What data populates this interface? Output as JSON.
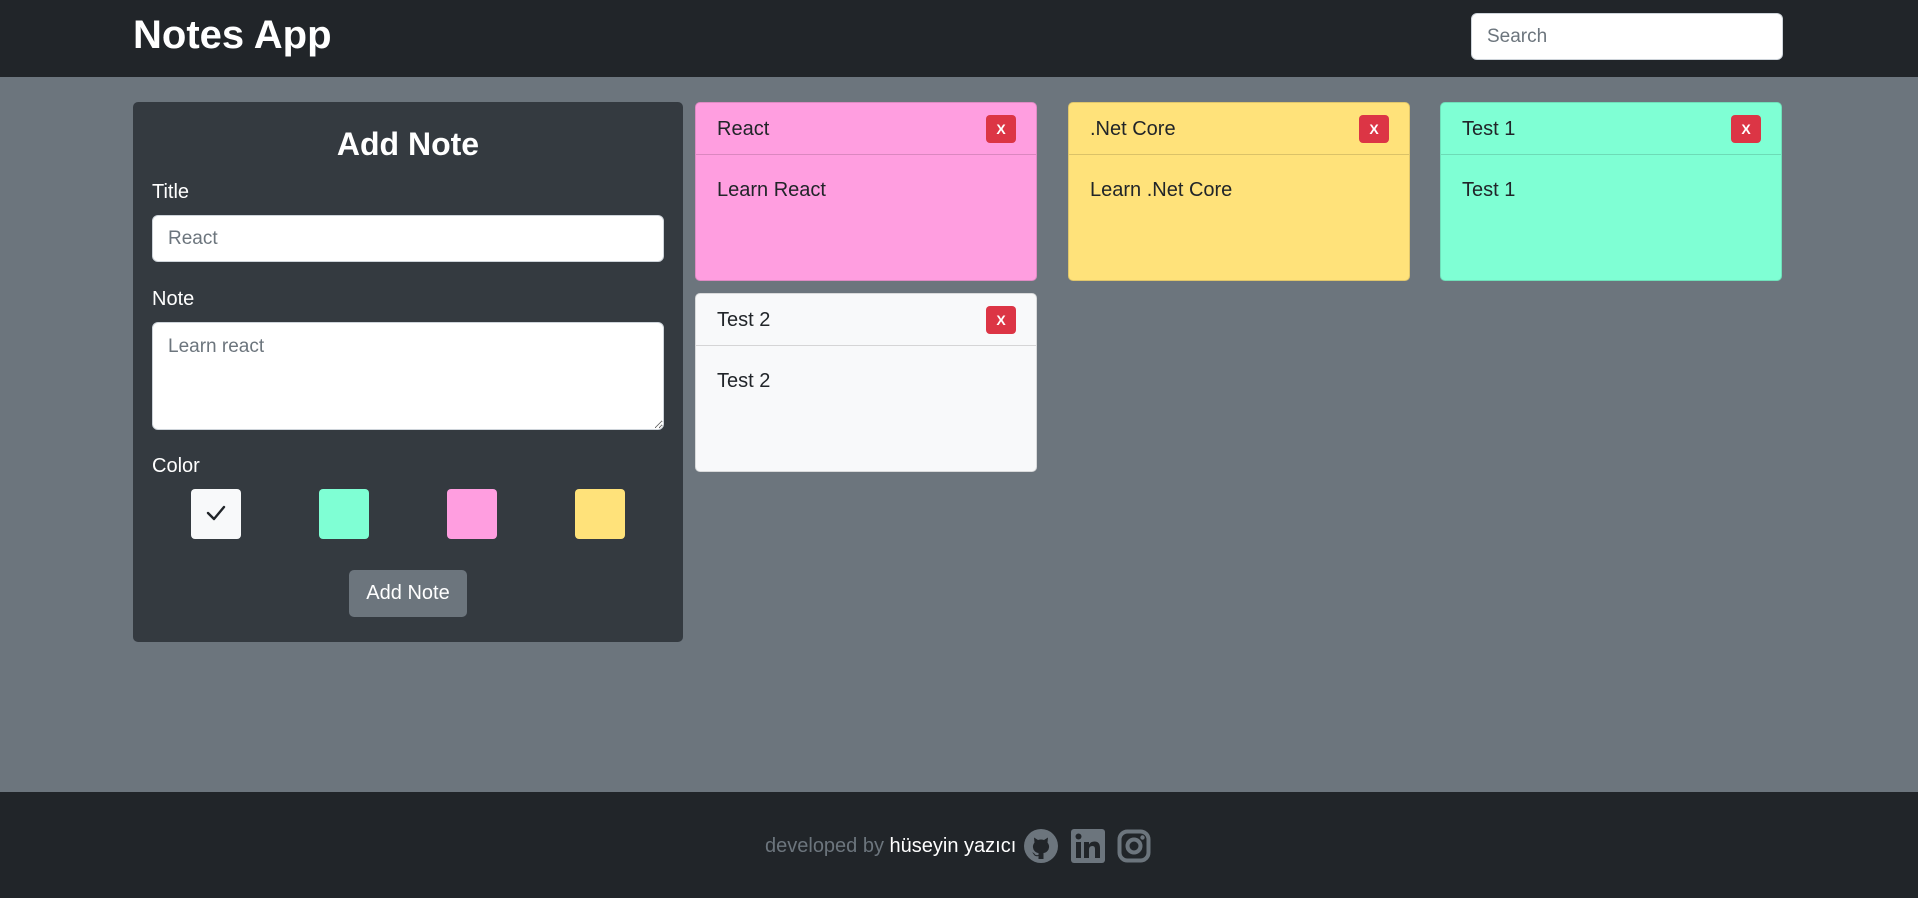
{
  "header": {
    "brand": "Notes App",
    "search_placeholder": "Search"
  },
  "add_note": {
    "heading": "Add Note",
    "title_label": "Title",
    "title_placeholder": "React",
    "note_label": "Note",
    "note_placeholder": "Learn react",
    "color_label": "Color",
    "colors": [
      {
        "value": "#f8f9fa",
        "selected": true
      },
      {
        "value": "#7fffd4",
        "selected": false
      },
      {
        "value": "#ff9ee0",
        "selected": false
      },
      {
        "value": "#ffe27a",
        "selected": false
      }
    ],
    "submit_label": "Add Note"
  },
  "notes": [
    {
      "title": "React",
      "body": "Learn React",
      "color": "#ff9ee0",
      "delete_label": "X"
    },
    {
      "title": ".Net Core",
      "body": "Learn .Net Core",
      "color": "#ffe27a",
      "delete_label": "X"
    },
    {
      "title": "Test 1",
      "body": "Test 1",
      "color": "#7fffd4",
      "delete_label": "X"
    },
    {
      "title": "Test 2",
      "body": "Test 2",
      "color": "#f8f9fa",
      "delete_label": "X"
    }
  ],
  "footer": {
    "prefix": "developed by",
    "author": "hüseyin yazıcı",
    "social_icons": [
      "github-icon",
      "linkedin-icon",
      "instagram-icon"
    ]
  }
}
